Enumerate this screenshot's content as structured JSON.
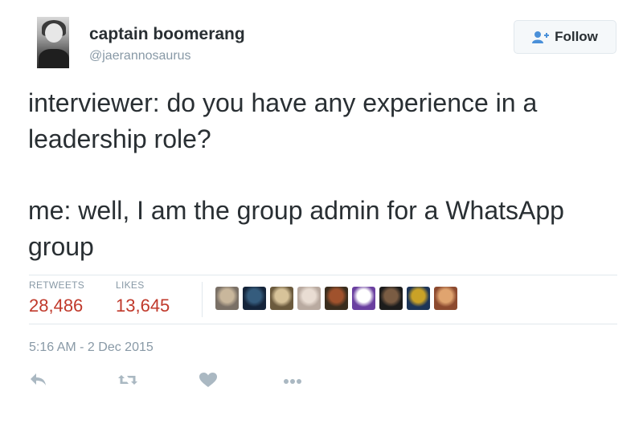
{
  "author": {
    "name": "captain boomerang",
    "handle": "@jaerannosaurus"
  },
  "follow_button": {
    "label": "Follow",
    "icon": "add-user-icon"
  },
  "tweet": {
    "paragraphs": [
      "interviewer: do you have any experience in a leadership role?",
      "me: well, I am the group admin for a WhatsApp group"
    ]
  },
  "stats": {
    "retweets_label": "RETWEETS",
    "retweets_count": "28,486",
    "likes_label": "LIKES",
    "likes_count": "13,645"
  },
  "likers": [
    {
      "colors": [
        "#7a7066",
        "#c9b79c"
      ]
    },
    {
      "colors": [
        "#14243a",
        "#355c7d"
      ]
    },
    {
      "colors": [
        "#6b5a3d",
        "#d7c39a"
      ]
    },
    {
      "colors": [
        "#b9aaa0",
        "#e9ddd3"
      ]
    },
    {
      "colors": [
        "#3a2d1e",
        "#a0522d"
      ]
    },
    {
      "colors": [
        "#6a3fa0",
        "#ffffff"
      ]
    },
    {
      "colors": [
        "#1c1c1c",
        "#7a5c43"
      ]
    },
    {
      "colors": [
        "#1d3557",
        "#c9a227"
      ]
    },
    {
      "colors": [
        "#8c4a2f",
        "#e0a46f"
      ]
    }
  ],
  "timestamp": "5:16 AM - 2 Dec 2015",
  "actions": [
    "reply-icon",
    "retweet-icon",
    "like-icon",
    "more-icon"
  ],
  "colors": {
    "stat_value": "#c0392b",
    "muted": "#8899a6",
    "icon": "#aab8c2",
    "divider": "#e1e8ed"
  }
}
